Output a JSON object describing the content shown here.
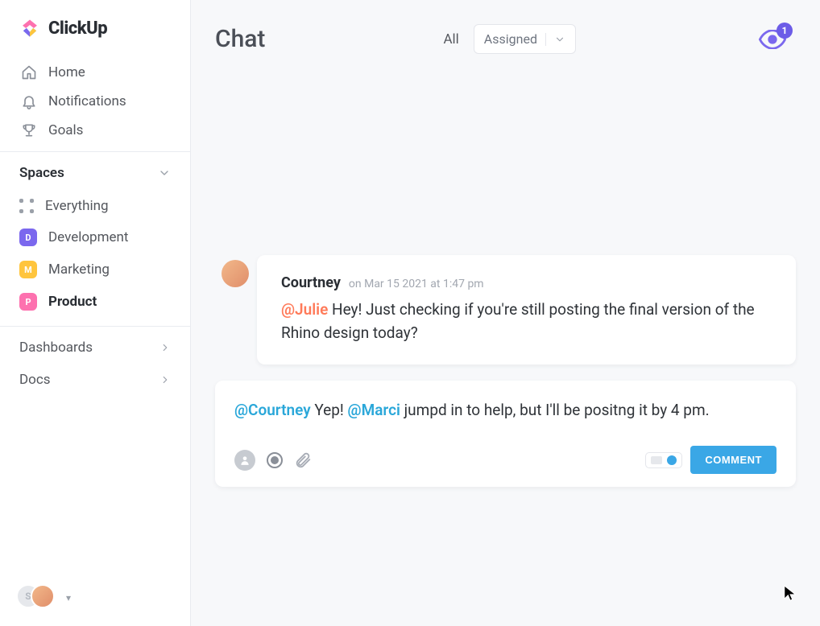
{
  "brand": {
    "name": "ClickUp"
  },
  "nav": {
    "home": "Home",
    "notifications": "Notifications",
    "goals": "Goals"
  },
  "spaces": {
    "header": "Spaces",
    "everything": "Everything",
    "items": [
      {
        "letter": "D",
        "label": "Development",
        "color": "#7b68ee"
      },
      {
        "letter": "M",
        "label": "Marketing",
        "color": "#ffc53d"
      },
      {
        "letter": "P",
        "label": "Product",
        "color": "#fd71af"
      }
    ]
  },
  "sideRows": {
    "dashboards": "Dashboards",
    "docs": "Docs"
  },
  "footer": {
    "initial": "S"
  },
  "header": {
    "title": "Chat",
    "filterAll": "All",
    "assigned": "Assigned",
    "watchCount": "1"
  },
  "message": {
    "author": "Courtney",
    "meta": "on Mar 15 2021 at 1:47 pm",
    "mention": "@Julie",
    "body": " Hey! Just checking if you're still posting the final version of the Rhino design today?"
  },
  "composer": {
    "mention1": "@Courtney",
    "text1": " Yep! ",
    "mention2": "@Marci",
    "text2": " jumpd in to help, but I'll be positng it by 4 pm.",
    "button": "COMMENT"
  }
}
